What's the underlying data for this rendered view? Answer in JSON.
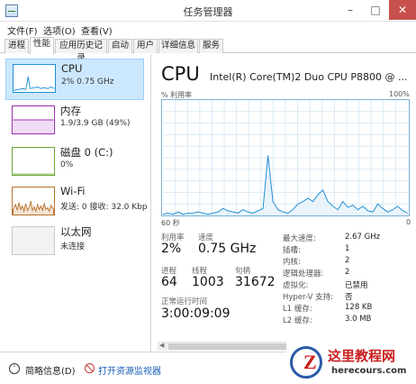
{
  "window": {
    "title": "任务管理器",
    "min_symbol": "–",
    "max_symbol": "□",
    "close_symbol": "✕"
  },
  "menu": [
    "文件(F)",
    "选项(O)",
    "查看(V)"
  ],
  "tabs": [
    "进程",
    "性能",
    "应用历史记录",
    "启动",
    "用户",
    "详细信息",
    "服务"
  ],
  "active_tab": "性能",
  "sidebar": {
    "items": [
      {
        "name": "CPU",
        "sub": "2% 0.75 GHz",
        "color": "#1e8ed6"
      },
      {
        "name": "内存",
        "sub": "1.9/3.9 GB (49%)",
        "color": "#9b2ab0"
      },
      {
        "name": "磁盘 0 (C:)",
        "sub": "0%",
        "color": "#6aa532"
      },
      {
        "name": "Wi-Fi",
        "sub": "发送: 0 接收: 32.0 Kbp",
        "color": "#b8732c"
      },
      {
        "name": "以太网",
        "sub": "未连接",
        "color": "#bbbbbb"
      }
    ]
  },
  "detail": {
    "heading": "CPU",
    "model": "Intel(R) Core(TM)2 Duo CPU P8800 @ ...",
    "y_label": "% 利用率",
    "y_max": "100%",
    "x_left": "60 秒",
    "x_right": "0",
    "graph_color": "#1e8ed6",
    "utilization": [
      1,
      2,
      1,
      3,
      1,
      2,
      2,
      3,
      2,
      1,
      2,
      3,
      6,
      4,
      3,
      2,
      5,
      3,
      2,
      4,
      6,
      52,
      12,
      5,
      3,
      2,
      5,
      10,
      12,
      15,
      12,
      18,
      22,
      12,
      8,
      5,
      12,
      7,
      9,
      5,
      8,
      4,
      3,
      10,
      6,
      3,
      5,
      8,
      4,
      2
    ],
    "stats": {
      "utilization_label": "利用率",
      "utilization_value": "2%",
      "speed_label": "速度",
      "speed_value": "0.75 GHz",
      "processes_label": "进程",
      "processes_value": "64",
      "threads_label": "线程",
      "threads_value": "1003",
      "handles_label": "句柄",
      "handles_value": "31672",
      "uptime_label": "正常运行时间",
      "uptime_value": "3:00:09:09"
    },
    "specs": [
      {
        "label": "最大速度:",
        "value": "2.67 GHz"
      },
      {
        "label": "插槽:",
        "value": "1"
      },
      {
        "label": "内核:",
        "value": "2"
      },
      {
        "label": "逻辑处理器:",
        "value": "2"
      },
      {
        "label": "虚拟化:",
        "value": "已禁用"
      },
      {
        "label": "Hyper-V 支持:",
        "value": "否"
      },
      {
        "label": "L1 缓存:",
        "value": "128 KB"
      },
      {
        "label": "L2 缓存:",
        "value": "3.0 MB"
      }
    ]
  },
  "footer": {
    "fewer_details": "简略信息(D)",
    "open_resmon": "打开资源监视器",
    "fewer_symbol": "˄"
  },
  "watermark": {
    "logo_letter": "Z",
    "title": "这里教程网",
    "url": "herecours.com"
  }
}
